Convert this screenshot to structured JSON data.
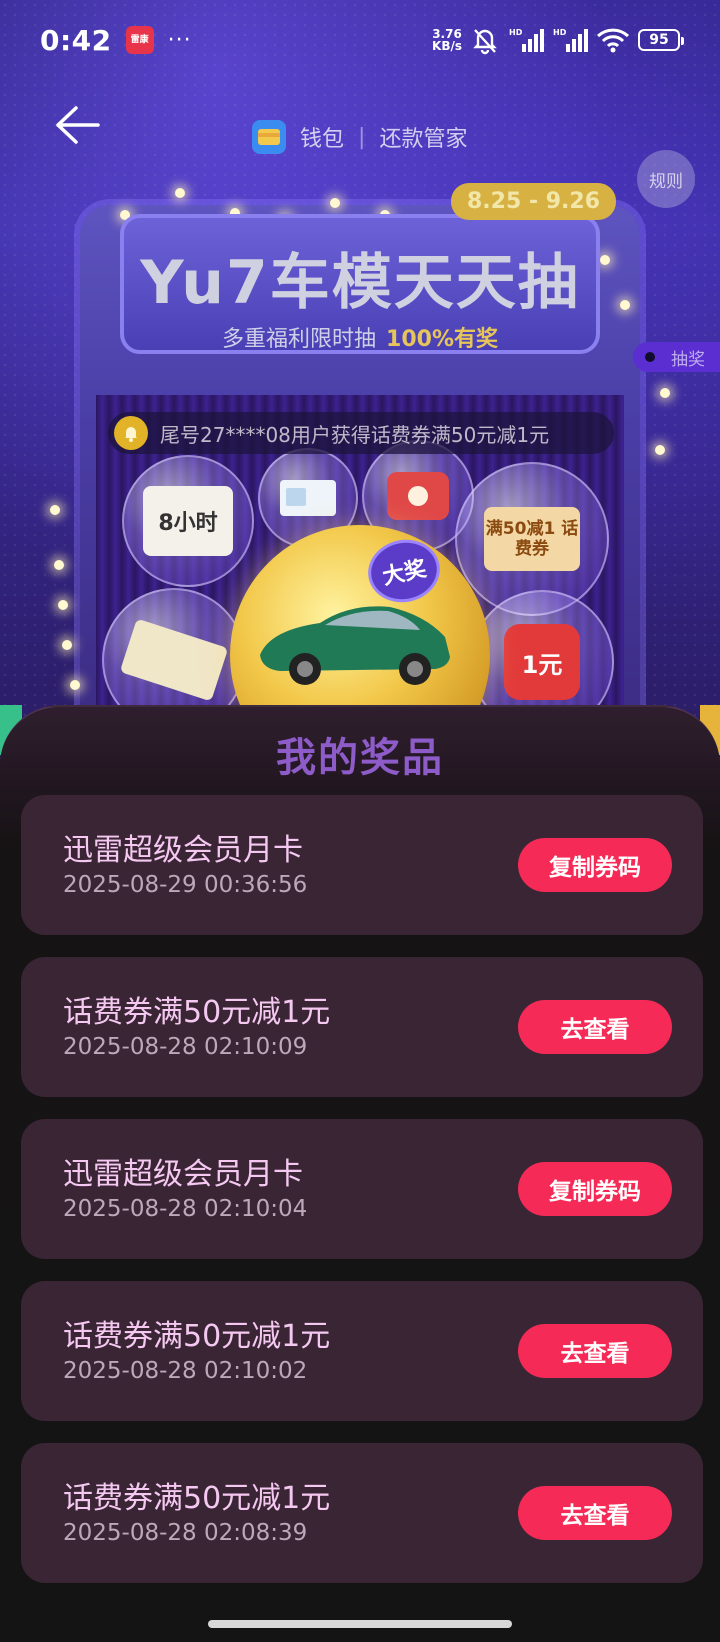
{
  "status_bar": {
    "time": "0:42",
    "app_badge": "雷康",
    "more": "···",
    "net_speed_value": "3.76",
    "net_speed_unit": "KB/s",
    "battery": "95"
  },
  "header": {
    "brand_wallet": "钱包",
    "brand_separator": "|",
    "brand_section": "还款管家",
    "rules_label": "规则"
  },
  "banner": {
    "date_range": "8.25 - 9.26",
    "title": "Yu7车模天天抽",
    "subtitle": "多重福利限时抽",
    "subtitle_highlight": "100%有奖",
    "side_tag": "抽奖",
    "ticker": "尾号27****08用户获得话费券满50元减1元",
    "big_badge": "大奖",
    "ball_card_hours": "8小时",
    "ball_card_phone": "满50减1 话费券",
    "ball_card_red": "1元"
  },
  "panel": {
    "title": "我的奖品",
    "prizes": [
      {
        "name": "迅雷超级会员月卡",
        "time": "2025-08-29 00:36:56",
        "action": "复制券码"
      },
      {
        "name": "话费券满50元减1元",
        "time": "2025-08-28 02:10:09",
        "action": "去查看"
      },
      {
        "name": "迅雷超级会员月卡",
        "time": "2025-08-28 02:10:04",
        "action": "复制券码"
      },
      {
        "name": "话费券满50元减1元",
        "time": "2025-08-28 02:10:02",
        "action": "去查看"
      },
      {
        "name": "话费券满50元减1元",
        "time": "2025-08-28 02:08:39",
        "action": "去查看"
      }
    ]
  },
  "colors": {
    "accent": "#f52a56",
    "card_bg": "#3a2535",
    "title_purple": "#8e5cc8"
  }
}
